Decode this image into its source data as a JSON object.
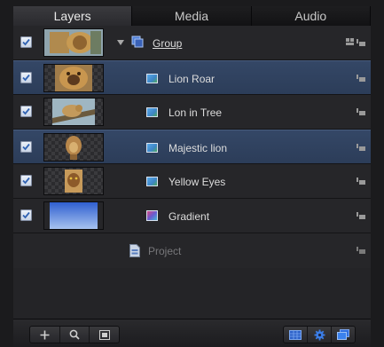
{
  "tabs": [
    {
      "label": "Layers",
      "active": true
    },
    {
      "label": "Media",
      "active": false
    },
    {
      "label": "Audio",
      "active": false
    }
  ],
  "layers": [
    {
      "name": "Group",
      "type": "group",
      "selected": false,
      "enabled": true
    },
    {
      "name": "Lion Roar",
      "type": "image",
      "selected": true,
      "enabled": true
    },
    {
      "name": "Lon in Tree",
      "type": "image",
      "selected": false,
      "enabled": true
    },
    {
      "name": "Majestic lion",
      "type": "image",
      "selected": true,
      "enabled": true
    },
    {
      "name": "Yellow Eyes",
      "type": "image",
      "selected": false,
      "enabled": true
    },
    {
      "name": "Gradient",
      "type": "gradient",
      "selected": false,
      "enabled": true
    }
  ],
  "project": {
    "name": "Project"
  },
  "footer": {
    "left_buttons": [
      "add-icon",
      "search-icon",
      "layout-icon"
    ],
    "right_buttons": [
      "grid-icon",
      "gear-icon",
      "windows-icon"
    ]
  },
  "colors": {
    "selection": "#2f4260",
    "accent": "#3a8ee6",
    "background": "#242427"
  }
}
